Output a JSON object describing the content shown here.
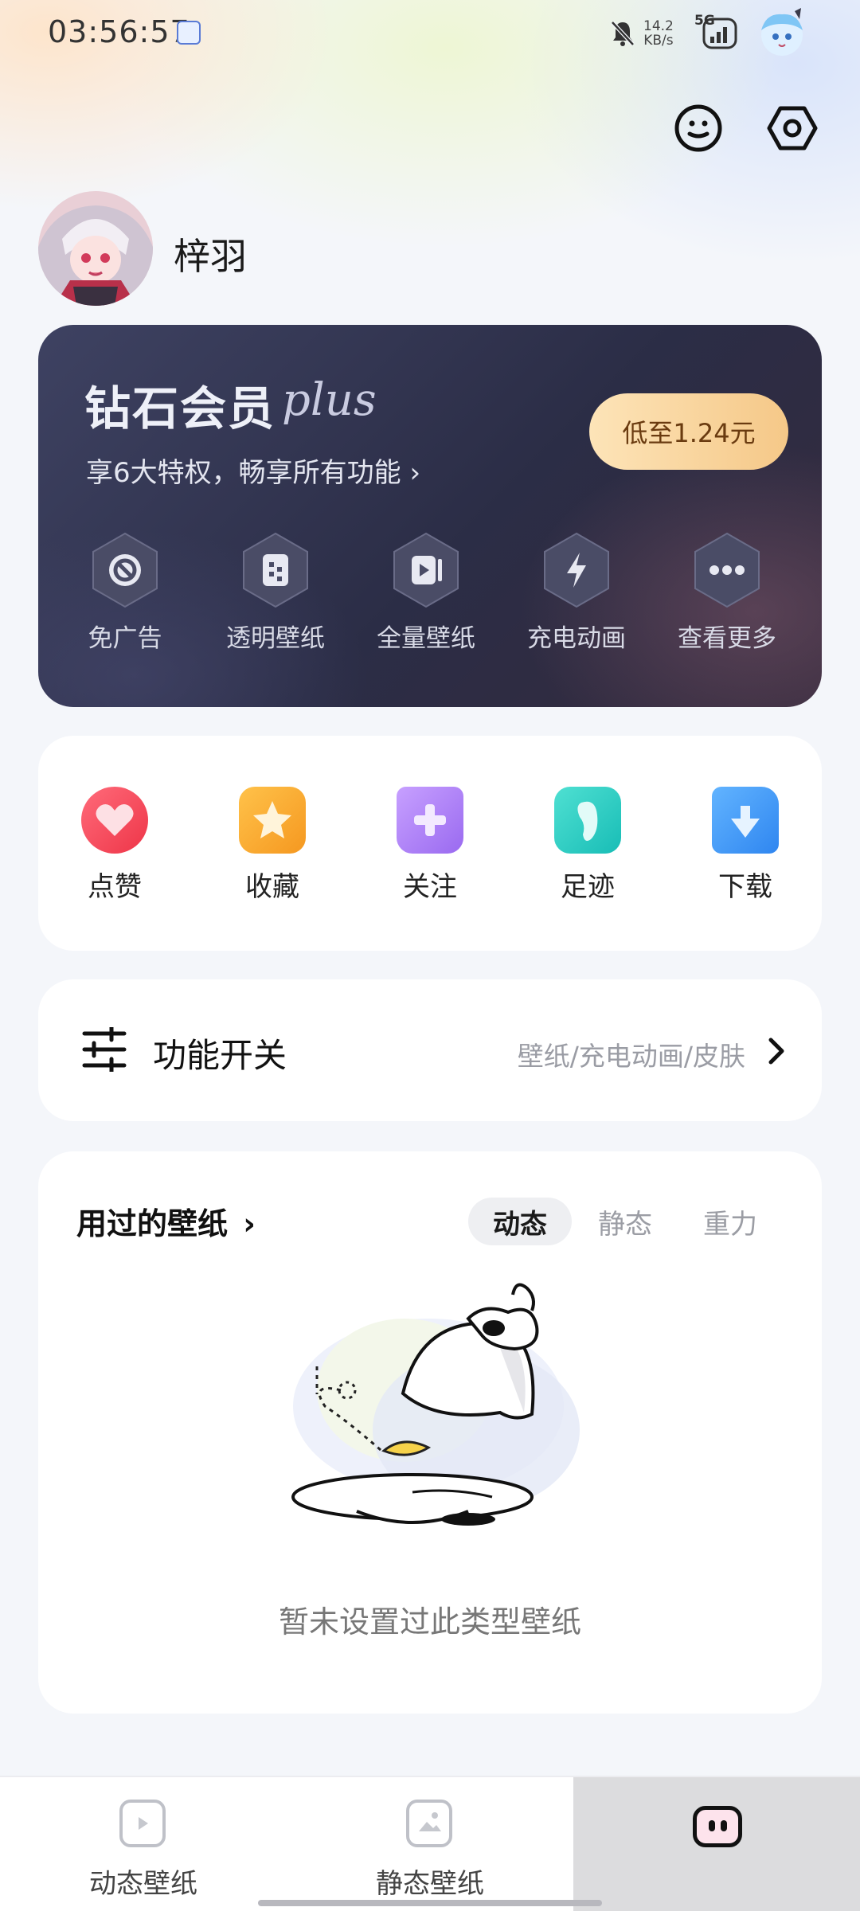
{
  "status_bar": {
    "time": "03:56:57",
    "net_speed_value": "14.2",
    "net_speed_unit": "KB/s",
    "network": "5G"
  },
  "header": {
    "icons": [
      "smiley-icon",
      "settings-hex-icon"
    ]
  },
  "profile": {
    "username": "梓羽"
  },
  "vip": {
    "title": "钻石会员",
    "plus": "plus",
    "subtitle": "享6大特权，畅享所有功能 ›",
    "price_button": "低至1.24元",
    "perks": [
      {
        "label": "免广告",
        "icon": "no-ads-icon"
      },
      {
        "label": "透明壁纸",
        "icon": "transparent-wallpaper-icon"
      },
      {
        "label": "全量壁纸",
        "icon": "full-wallpaper-icon"
      },
      {
        "label": "充电动画",
        "icon": "charging-icon"
      },
      {
        "label": "查看更多",
        "icon": "more-icon"
      }
    ]
  },
  "actions": [
    {
      "label": "点赞",
      "icon": "heart-icon",
      "color": "#f2475a"
    },
    {
      "label": "收藏",
      "icon": "star-icon",
      "color": "#f7a52a"
    },
    {
      "label": "关注",
      "icon": "follow-plus-icon",
      "color": "#a070f0"
    },
    {
      "label": "足迹",
      "icon": "footprint-icon",
      "color": "#22c7c0"
    },
    {
      "label": "下载",
      "icon": "download-icon",
      "color": "#3d93f5"
    }
  ],
  "function_switch": {
    "title": "功能开关",
    "subtitle": "壁纸/充电动画/皮肤"
  },
  "used_wallpapers": {
    "title": "用过的壁纸",
    "tabs": [
      "动态",
      "静态",
      "重力"
    ],
    "selected_tab": "动态",
    "empty_text": "暂未设置过此类型壁纸"
  },
  "bottom_nav": [
    {
      "label": "动态壁纸",
      "icon": "dynamic-wallpaper-icon"
    },
    {
      "label": "静态壁纸",
      "icon": "static-wallpaper-icon"
    },
    {
      "label": "",
      "icon": "mine-face-icon"
    }
  ]
}
